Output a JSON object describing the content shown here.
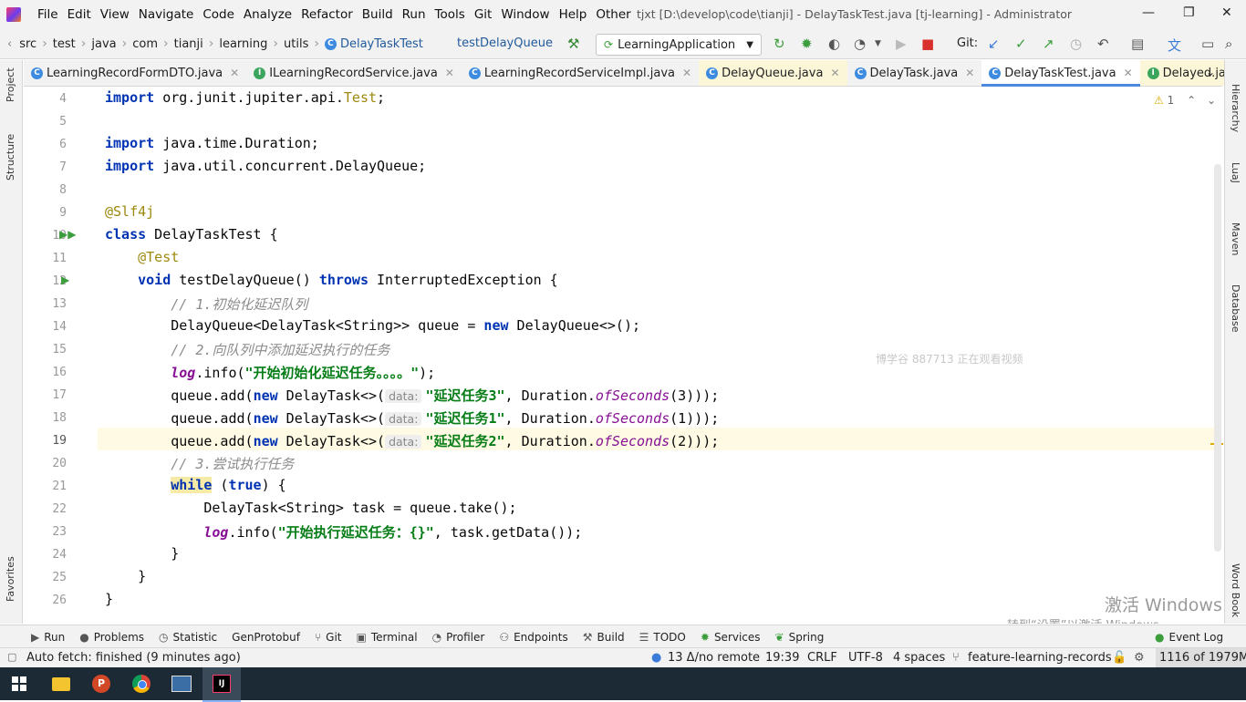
{
  "menubar": {
    "items": [
      "File",
      "Edit",
      "View",
      "Navigate",
      "Code",
      "Analyze",
      "Refactor",
      "Build",
      "Run",
      "Tools",
      "Git",
      "Window",
      "Help",
      "Other"
    ],
    "title": "tjxt [D:\\develop\\code\\tianji] - DelayTaskTest.java [tj-learning] - Administrator"
  },
  "navbar": {
    "breadcrumbs": [
      "src",
      "test",
      "java",
      "com",
      "tianji",
      "learning",
      "utils",
      "DelayTaskTest"
    ],
    "method": "testDelayQueue",
    "run_config": "LearningApplication",
    "git_label": "Git:"
  },
  "tabs": [
    {
      "label": "LearningRecordFormDTO.java",
      "icon": "class-icon"
    },
    {
      "label": "ILearningRecordService.java",
      "icon": "interface-icon"
    },
    {
      "label": "LearningRecordServiceImpl.java",
      "icon": "class-icon"
    },
    {
      "label": "DelayQueue.java",
      "icon": "class-icon"
    },
    {
      "label": "DelayTask.java",
      "icon": "class-icon"
    },
    {
      "label": "DelayTaskTest.java",
      "icon": "class-icon",
      "active": true
    },
    {
      "label": "Delayed.java",
      "icon": "interface-icon"
    }
  ],
  "left_tools": [
    "Project",
    "Structure",
    "Favorites"
  ],
  "right_tools": [
    "Hierarchy",
    "LuaJ",
    "Maven",
    "Database",
    "Word Book"
  ],
  "editor": {
    "warnings": "1",
    "line_numbers": [
      "4",
      "5",
      "6",
      "7",
      "8",
      "9",
      "10",
      "11",
      "12",
      "13",
      "14",
      "15",
      "16",
      "17",
      "18",
      "19",
      "20",
      "21",
      "22",
      "23",
      "24",
      "25",
      "26"
    ],
    "inlay_hint": "data:",
    "watermark": "博学谷 887713 正在观看视频"
  },
  "activation": {
    "title": "激活 Windows",
    "subtitle": "转到“设置”以激活 Windows。"
  },
  "toolwindows": [
    "Run",
    "Problems",
    "Statistic",
    "GenProtobuf",
    "Git",
    "Terminal",
    "Profiler",
    "Endpoints",
    "Build",
    "TODO",
    "Services",
    "Spring",
    "Event Log"
  ],
  "status": {
    "message": "Auto fetch: finished (9 minutes ago)",
    "git_remote": "13 Δ/no remote",
    "position": "19:39",
    "line_sep": "CRLF",
    "encoding": "UTF-8",
    "indent": "4 spaces",
    "branch": "feature-learning-records",
    "memory": "1116 of 1979M"
  },
  "colors": {
    "accent": "#4a89dc",
    "keyword": "#0033b3",
    "string": "#067d17",
    "comment": "#8c8c8c",
    "annotation": "#9e880d"
  }
}
